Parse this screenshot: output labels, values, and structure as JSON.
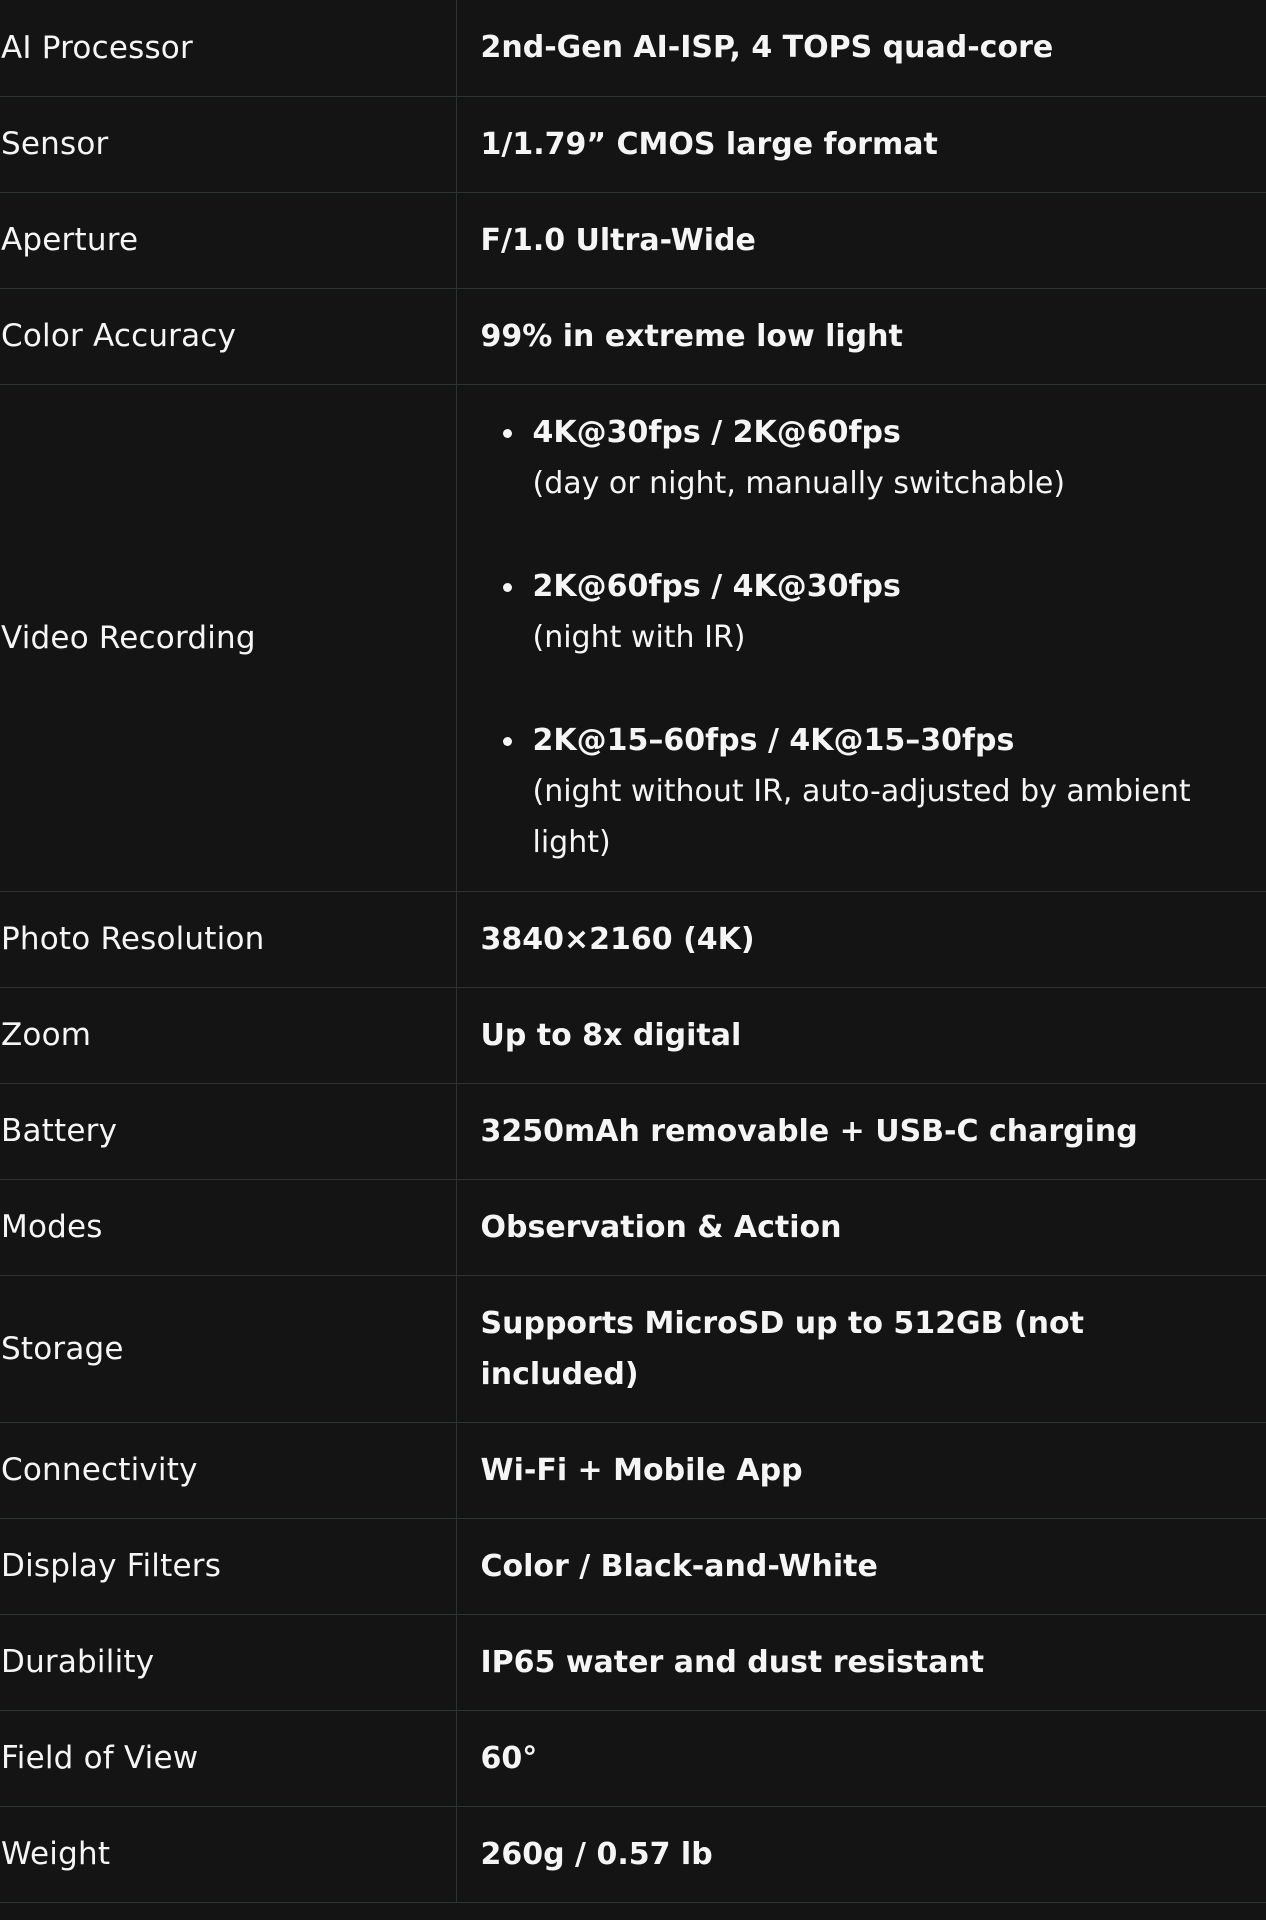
{
  "specs": [
    {
      "label": "AI Processor",
      "value": "2nd-Gen AI-ISP, 4 TOPS quad-core"
    },
    {
      "label": "Sensor",
      "value": "1/1.79” CMOS large format"
    },
    {
      "label": "Aperture",
      "value": "F/1.0 Ultra-Wide"
    },
    {
      "label": "Color Accuracy",
      "value": "99% in extreme low light"
    },
    {
      "label": "Photo Resolution",
      "value": "3840×2160 (4K)"
    },
    {
      "label": "Zoom",
      "value": "Up to 8x digital"
    },
    {
      "label": "Battery",
      "value": "3250mAh removable + USB-C charging"
    },
    {
      "label": "Modes",
      "value": "Observation & Action"
    },
    {
      "label": "Storage",
      "value": "Supports MicroSD up to 512GB (not included)"
    },
    {
      "label": "Connectivity",
      "value": "Wi-Fi + Mobile App"
    },
    {
      "label": "Display Filters",
      "value": "Color / Black-and-White"
    },
    {
      "label": "Durability",
      "value": "IP65 water and dust resistant"
    },
    {
      "label": "Field of View",
      "value": "60°"
    },
    {
      "label": "Weight",
      "value": "260g / 0.57 lb"
    }
  ],
  "video": {
    "label": "Video Recording",
    "items": [
      {
        "title": "4K@30fps / 2K@60fps",
        "note": "(day or night, manually switchable)"
      },
      {
        "title": "2K@60fps / 4K@30fps",
        "note": "(night with IR)"
      },
      {
        "title": "2K@15–60fps / 4K@15–30fps",
        "note": "(night without IR, auto-adjusted by ambient light)"
      }
    ]
  }
}
